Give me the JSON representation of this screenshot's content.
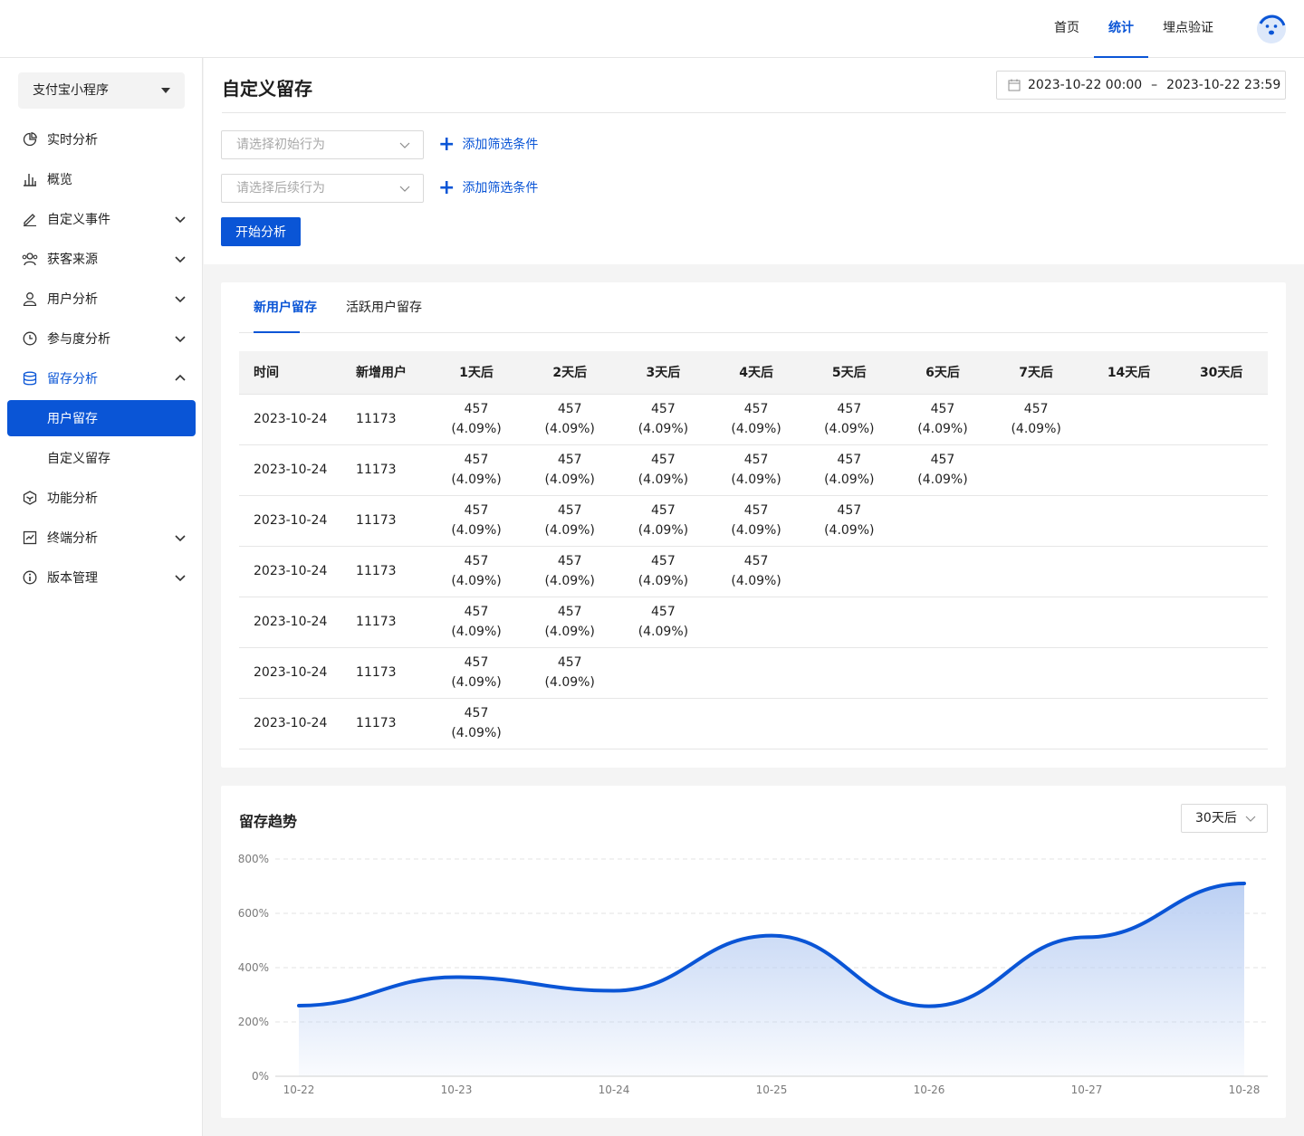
{
  "topnav": {
    "items": [
      "首页",
      "统计",
      "埋点验证"
    ],
    "active": 1
  },
  "avatar_icon": "bear-face-icon",
  "sidebar": {
    "app_name": "支付宝小程序",
    "items": [
      {
        "label": "实时分析",
        "icon": "pie-chart-icon"
      },
      {
        "label": "概览",
        "icon": "bar-chart-icon"
      },
      {
        "label": "自定义事件",
        "icon": "pen-icon",
        "chevron": "down"
      },
      {
        "label": "获客来源",
        "icon": "users-icon",
        "chevron": "down"
      },
      {
        "label": "用户分析",
        "icon": "user-icon",
        "chevron": "down"
      },
      {
        "label": "参与度分析",
        "icon": "clock-icon",
        "chevron": "down"
      },
      {
        "label": "留存分析",
        "icon": "database-icon",
        "chevron": "up"
      },
      {
        "label": "用户留存"
      },
      {
        "label": "自定义留存"
      },
      {
        "label": "功能分析",
        "icon": "cube-icon"
      },
      {
        "label": "终端分析",
        "icon": "monitor-chart-icon",
        "chevron": "down"
      },
      {
        "label": "版本管理",
        "icon": "info-icon",
        "chevron": "down"
      }
    ]
  },
  "header": {
    "title": "自定义留存",
    "date_start": "2023-10-22 00:00",
    "date_sep": "–",
    "date_end": "2023-10-22 23:59",
    "initial_placeholder": "请选择初始行为",
    "followup_placeholder": "请选择后续行为",
    "add_filter_label": "添加筛选条件",
    "start_button": "开始分析"
  },
  "tabs": [
    "新用户留存",
    "活跃用户留存"
  ],
  "table": {
    "columns": [
      "时间",
      "新增用户",
      "1天后",
      "2天后",
      "3天后",
      "4天后",
      "5天后",
      "6天后",
      "7天后",
      "14天后",
      "30天后"
    ],
    "rows": [
      {
        "date": "2023-10-24",
        "new_users": "11173",
        "cells": [
          [
            "457",
            "(4.09%)"
          ],
          [
            "457",
            "(4.09%)"
          ],
          [
            "457",
            "(4.09%)"
          ],
          [
            "457",
            "(4.09%)"
          ],
          [
            "457",
            "(4.09%)"
          ],
          [
            "457",
            "(4.09%)"
          ],
          [
            "457",
            "(4.09%)"
          ]
        ]
      },
      {
        "date": "2023-10-24",
        "new_users": "11173",
        "cells": [
          [
            "457",
            "(4.09%)"
          ],
          [
            "457",
            "(4.09%)"
          ],
          [
            "457",
            "(4.09%)"
          ],
          [
            "457",
            "(4.09%)"
          ],
          [
            "457",
            "(4.09%)"
          ],
          [
            "457",
            "(4.09%)"
          ]
        ]
      },
      {
        "date": "2023-10-24",
        "new_users": "11173",
        "cells": [
          [
            "457",
            "(4.09%)"
          ],
          [
            "457",
            "(4.09%)"
          ],
          [
            "457",
            "(4.09%)"
          ],
          [
            "457",
            "(4.09%)"
          ],
          [
            "457",
            "(4.09%)"
          ]
        ]
      },
      {
        "date": "2023-10-24",
        "new_users": "11173",
        "cells": [
          [
            "457",
            "(4.09%)"
          ],
          [
            "457",
            "(4.09%)"
          ],
          [
            "457",
            "(4.09%)"
          ],
          [
            "457",
            "(4.09%)"
          ]
        ]
      },
      {
        "date": "2023-10-24",
        "new_users": "11173",
        "cells": [
          [
            "457",
            "(4.09%)"
          ],
          [
            "457",
            "(4.09%)"
          ],
          [
            "457",
            "(4.09%)"
          ]
        ]
      },
      {
        "date": "2023-10-24",
        "new_users": "11173",
        "cells": [
          [
            "457",
            "(4.09%)"
          ],
          [
            "457",
            "(4.09%)"
          ]
        ]
      },
      {
        "date": "2023-10-24",
        "new_users": "11173",
        "cells": [
          [
            "457",
            "(4.09%)"
          ]
        ]
      }
    ]
  },
  "trend": {
    "title": "留存趋势",
    "range_label": "30天后"
  },
  "colors": {
    "primary": "#0a55d6",
    "area_top": "#bcd0f3"
  },
  "chart_data": {
    "type": "area",
    "title": "留存趋势",
    "x": [
      "10-22",
      "10-23",
      "10-24",
      "10-25",
      "10-26",
      "10-27",
      "10-28"
    ],
    "series": [
      {
        "values": [
          260,
          365,
          315,
          518,
          258,
          512,
          710
        ]
      }
    ],
    "yticks": [
      "0%",
      "200%",
      "400%",
      "600%",
      "800%"
    ],
    "ylim": [
      0,
      800
    ],
    "grid": true,
    "smooth": true
  }
}
